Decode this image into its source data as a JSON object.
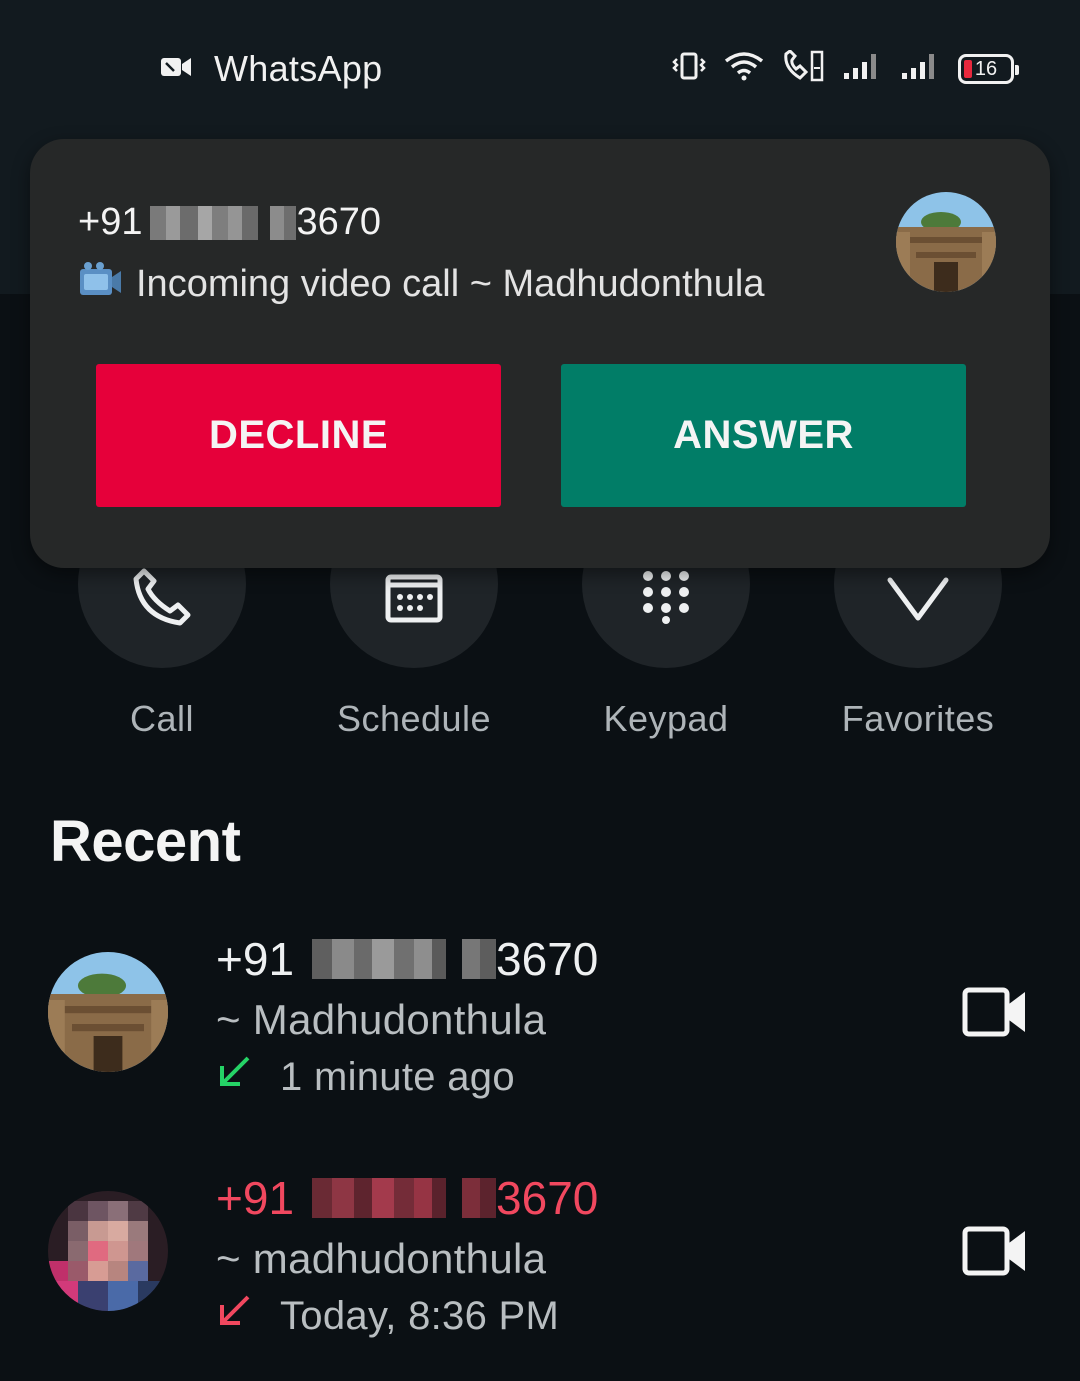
{
  "status_bar": {
    "app_icon": "video-camera-icon",
    "app_name": "WhatsApp",
    "icons": [
      "vibrate-icon",
      "wifi-icon",
      "wifi-calling-icon",
      "signal-icon",
      "signal-icon"
    ],
    "battery_level": "16",
    "battery_color": "#e8283d"
  },
  "notification": {
    "number_prefix": "+91",
    "number_suffix": "3670",
    "call_icon": "video-camera-emoji-icon",
    "subtitle": "Incoming video call ~ Madhudonthula",
    "decline_label": "DECLINE",
    "answer_label": "ANSWER",
    "decline_color": "#e6003a",
    "answer_color": "#017d67"
  },
  "actions": [
    {
      "label": "Call",
      "icon": "phone-icon"
    },
    {
      "label": "Schedule",
      "icon": "calendar-icon"
    },
    {
      "label": "Keypad",
      "icon": "keypad-icon"
    },
    {
      "label": "Favorites",
      "icon": "heart-icon"
    }
  ],
  "recent": {
    "title": "Recent",
    "items": [
      {
        "number_prefix": "+91",
        "number_suffix": "3670",
        "name": "~ Madhudonthula",
        "time": "1 minute ago",
        "direction_icon": "incoming-arrow-icon",
        "direction_color": "#25d366",
        "missed": false,
        "action_icon": "video-call-icon"
      },
      {
        "number_prefix": "+91",
        "number_suffix": "3670",
        "name": "~ madhudonthula",
        "time": "Today, 8:36 PM",
        "direction_icon": "missed-call-arrow-icon",
        "direction_color": "#f1485f",
        "missed": true,
        "action_icon": "video-call-icon"
      }
    ]
  }
}
